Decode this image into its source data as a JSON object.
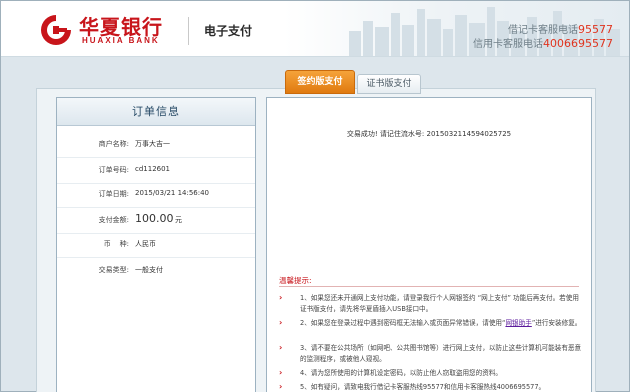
{
  "header": {
    "bank_name_cn": "华夏银行",
    "bank_name_en": "HUAXIA BANK",
    "service": "电子支付",
    "debit_hotline_label": "借记卡客服电话",
    "debit_hotline_number": "95577",
    "credit_hotline_label": "信用卡客服电话",
    "credit_hotline_number": "4006695577"
  },
  "tabs": [
    {
      "label": "签约版支付",
      "active": true
    },
    {
      "label": "证书版支付",
      "active": false
    }
  ],
  "order": {
    "title": "订单信息",
    "fields": [
      {
        "label": "商户名称:",
        "value": "万事大吉一"
      },
      {
        "label": "订单号码:",
        "value": "cd112601"
      },
      {
        "label": "订单日期:",
        "value": "2015/03/21 14:56:40"
      },
      {
        "label": "支付金额:",
        "value": "100.00",
        "unit": "元"
      },
      {
        "label": "币    种:",
        "value": "人民币"
      },
      {
        "label": "交易类型:",
        "value": "一般支付"
      }
    ]
  },
  "result": {
    "message": "交易成功! 请记住流水号: 2015032114594025725",
    "tips_title": "温馨提示:",
    "tips": [
      "1、如果您还未开通网上支付功能，请登录我行个人网银签约 “网上支付” 功能后再支付。若使用证书版支付，请先将华夏盾插入USB接口中。",
      "2、如果您在登录过程中遇到密码框无法输入或页面异常错误，请使用“",
      "3、请不要在公共场所（如网吧、公共图书馆等）进行网上支付，以防止这些计算机可能装有恶意的监测程序，或被他人窥视。",
      "4、请为您所使用的计算机设定密码，以防止他人窃取盗用您的资料。",
      "5、如有疑问，请致电我行借记卡客服热线95577和信用卡客服热线4006695577。"
    ],
    "tip2_link": "网银助手",
    "tip2_suffix": "”进行安装修复。"
  },
  "colors": {
    "brand_red": "#c8151b",
    "tab_orange": "#e07a10",
    "hotline_number": "#e0341f"
  }
}
